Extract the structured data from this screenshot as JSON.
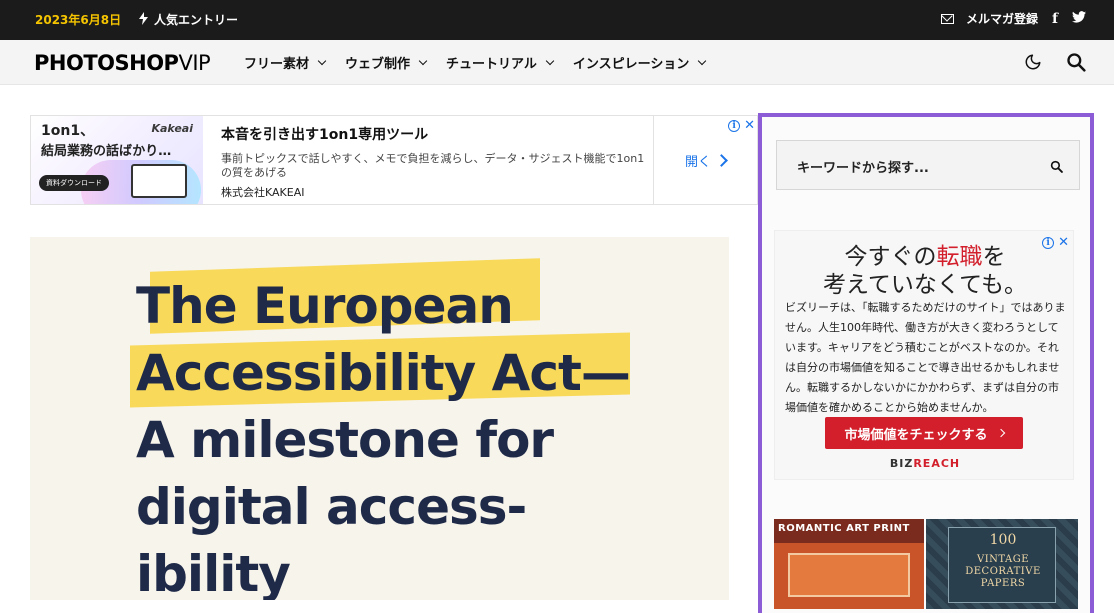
{
  "topbar": {
    "date": "2023年6月8日",
    "popular_label": "人気エントリー",
    "newsletter_label": "メルマガ登録",
    "social_facebook": "f",
    "social_twitter": "twitter"
  },
  "header": {
    "logo_main": "PHOTOSHOP",
    "logo_sub": "VIP",
    "nav": [
      {
        "label": "フリー素材"
      },
      {
        "label": "ウェブ制作"
      },
      {
        "label": "チュートリアル"
      },
      {
        "label": "インスピレーション"
      }
    ]
  },
  "ad_banner": {
    "image_line1": "1on1、",
    "image_line2": "結局業務の話ばかり…",
    "image_brand": "Kakeai",
    "image_download": "資料ダウンロード",
    "title": "本音を引き出す1on1専用ツール",
    "body": "事前トピックスで話しやすく、メモで負担を減らし、データ・サジェスト機能で1on1の質をあげる",
    "company": "株式会社KAKEAI",
    "cta": "開く"
  },
  "hero": {
    "line1": "The European",
    "line2": "Accessibility Act—",
    "line3": "A milestone for",
    "line4": "digital access-",
    "line5": "ibility"
  },
  "sidebar": {
    "search_placeholder": "キーワードから探す...",
    "ad": {
      "head_pre": "今すぐの",
      "head_red": "転職",
      "head_post": "を",
      "head2": "考えていなくても。",
      "body": "ビズリーチは、「転職するためだけのサイト」ではありません。人生100年時代、働き方が大きく変わろうとしています。キャリアをどう積むことがベストなのか。それは自分の市場価値を知ることで導き出せるかもしれません。転職するかしないかにかかわらず、まずは自分の市場価値を確かめることから始めませんか。",
      "button": "市場価値をチェックする",
      "brand_a": "BIZ",
      "brand_b": "REACH"
    },
    "promo1_title": "ROMANTIC ART PRINT",
    "promo2_num": "100",
    "promo2_text": "VINTAGE DECORATIVE PAPERS"
  },
  "colors": {
    "topbar_bg": "#1b1b1b",
    "date_color": "#f5c400",
    "sidebar_border": "#8b5cd6",
    "hero_text": "#1f2a48",
    "hero_highlight": "#f8d95a",
    "ad_red": "#d21f2b",
    "link_blue": "#1a73e8"
  }
}
